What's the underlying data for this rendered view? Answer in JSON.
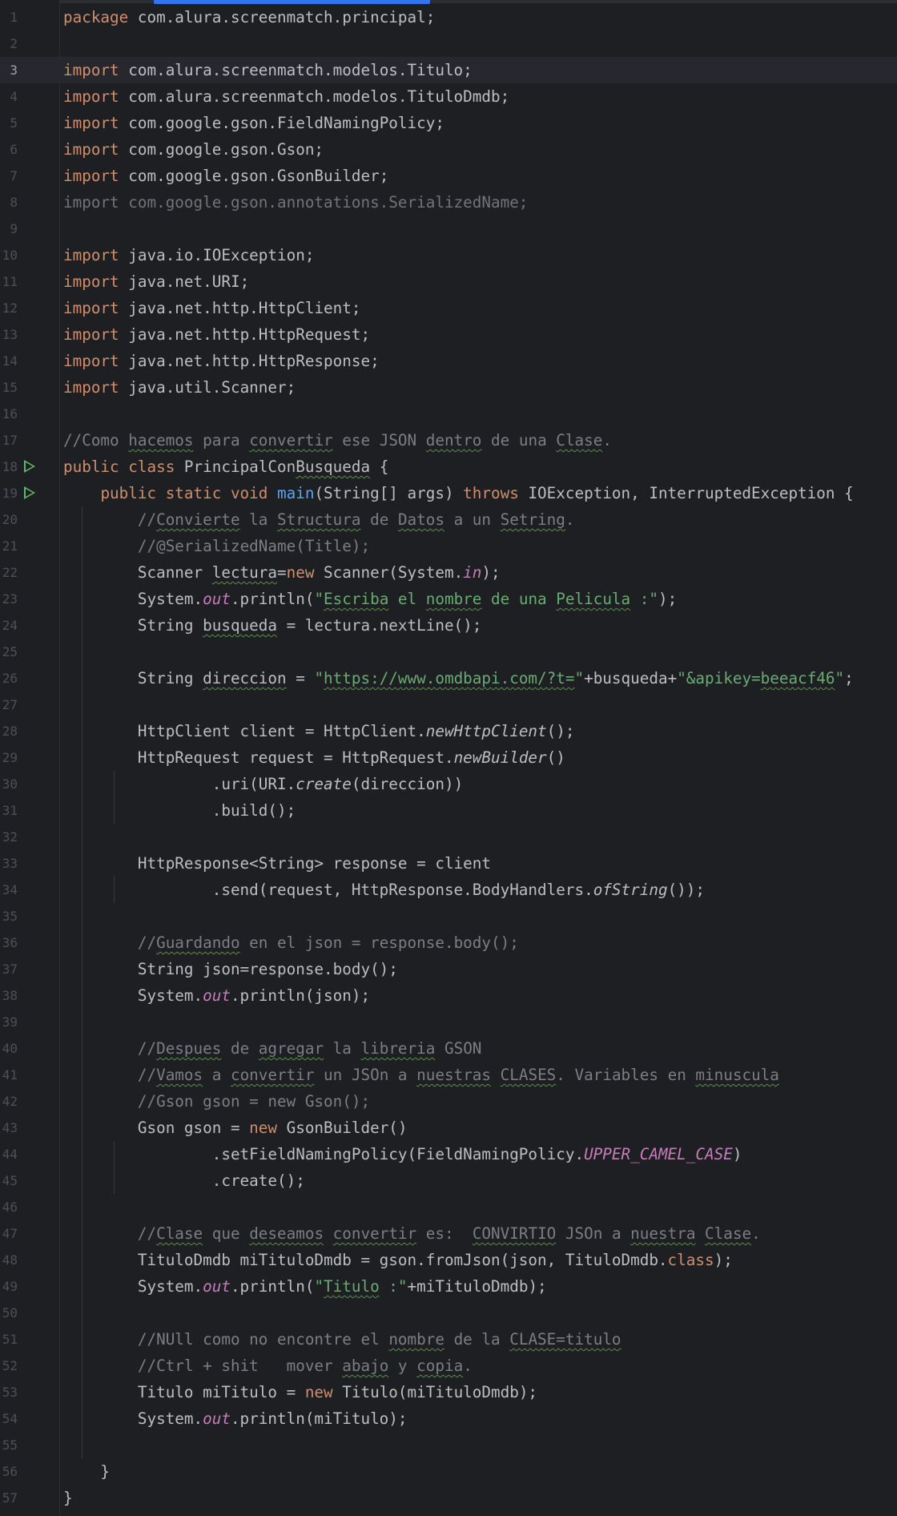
{
  "editor": {
    "current_line": 3,
    "lines": [
      {
        "n": 1,
        "tokens": [
          {
            "t": "package ",
            "c": "kw"
          },
          {
            "t": "com.alura.screenmatch.principal;"
          }
        ]
      },
      {
        "n": 2,
        "tokens": []
      },
      {
        "n": 3,
        "tokens": [
          {
            "t": "import ",
            "c": "kw"
          },
          {
            "t": "com.alura.screenmatch.modelos.Titulo;"
          }
        ]
      },
      {
        "n": 4,
        "tokens": [
          {
            "t": "import ",
            "c": "kw"
          },
          {
            "t": "com.alura.screenmatch.modelos.TituloDmdb;"
          }
        ]
      },
      {
        "n": 5,
        "tokens": [
          {
            "t": "import ",
            "c": "kw"
          },
          {
            "t": "com.google.gson.FieldNamingPolicy;"
          }
        ]
      },
      {
        "n": 6,
        "tokens": [
          {
            "t": "import ",
            "c": "kw"
          },
          {
            "t": "com.google.gson.Gson;"
          }
        ]
      },
      {
        "n": 7,
        "tokens": [
          {
            "t": "import ",
            "c": "kw"
          },
          {
            "t": "com.google.gson.GsonBuilder;"
          }
        ]
      },
      {
        "n": 8,
        "tokens": [
          {
            "t": "import com.google.gson.annotations.SerializedName;",
            "c": "dim"
          }
        ]
      },
      {
        "n": 9,
        "tokens": []
      },
      {
        "n": 10,
        "tokens": [
          {
            "t": "import ",
            "c": "kw"
          },
          {
            "t": "java.io.IOException;"
          }
        ]
      },
      {
        "n": 11,
        "tokens": [
          {
            "t": "import ",
            "c": "kw"
          },
          {
            "t": "java.net.URI;"
          }
        ]
      },
      {
        "n": 12,
        "tokens": [
          {
            "t": "import ",
            "c": "kw"
          },
          {
            "t": "java.net.http.HttpClient;"
          }
        ]
      },
      {
        "n": 13,
        "tokens": [
          {
            "t": "import ",
            "c": "kw"
          },
          {
            "t": "java.net.http.HttpRequest;"
          }
        ]
      },
      {
        "n": 14,
        "tokens": [
          {
            "t": "import ",
            "c": "kw"
          },
          {
            "t": "java.net.http.HttpResponse;"
          }
        ]
      },
      {
        "n": 15,
        "tokens": [
          {
            "t": "import ",
            "c": "kw"
          },
          {
            "t": "java.util.Scanner;"
          }
        ]
      },
      {
        "n": 16,
        "tokens": []
      },
      {
        "n": 17,
        "tokens": [
          {
            "t": "//Como ",
            "c": "cmt"
          },
          {
            "t": "hacemos",
            "c": "cmt typo"
          },
          {
            "t": " para ",
            "c": "cmt"
          },
          {
            "t": "convertir",
            "c": "cmt typo"
          },
          {
            "t": " ese JSON ",
            "c": "cmt"
          },
          {
            "t": "dentro",
            "c": "cmt typo"
          },
          {
            "t": " de una ",
            "c": "cmt"
          },
          {
            "t": "Clase",
            "c": "cmt typo"
          },
          {
            "t": ".",
            "c": "cmt"
          }
        ]
      },
      {
        "n": 18,
        "run": true,
        "tokens": [
          {
            "t": "public class ",
            "c": "kw"
          },
          {
            "t": "PrincipalCon"
          },
          {
            "t": "Busqueda",
            "c": "typo"
          },
          {
            "t": " {"
          }
        ]
      },
      {
        "n": 19,
        "run": true,
        "tokens": [
          {
            "t": "    "
          },
          {
            "t": "public static void ",
            "c": "kw"
          },
          {
            "t": "main",
            "c": "fn"
          },
          {
            "t": "(String[] args) "
          },
          {
            "t": "throws ",
            "c": "kw"
          },
          {
            "t": "IOException, InterruptedException {"
          }
        ]
      },
      {
        "n": 20,
        "tokens": [
          {
            "t": "        "
          },
          {
            "t": "//",
            "c": "cmt"
          },
          {
            "t": "Convierte",
            "c": "cmt typo"
          },
          {
            "t": " la ",
            "c": "cmt"
          },
          {
            "t": "Structura",
            "c": "cmt typo"
          },
          {
            "t": " de ",
            "c": "cmt"
          },
          {
            "t": "Datos",
            "c": "cmt typo"
          },
          {
            "t": " a un ",
            "c": "cmt"
          },
          {
            "t": "Setring",
            "c": "cmt typo"
          },
          {
            "t": ".",
            "c": "cmt"
          }
        ]
      },
      {
        "n": 21,
        "tokens": [
          {
            "t": "        "
          },
          {
            "t": "//@SerializedName(Title);",
            "c": "cmt"
          }
        ]
      },
      {
        "n": 22,
        "tokens": [
          {
            "t": "        Scanner "
          },
          {
            "t": "lectura",
            "c": "typo"
          },
          {
            "t": "="
          },
          {
            "t": "new ",
            "c": "kw"
          },
          {
            "t": "Scanner(System."
          },
          {
            "t": "in",
            "c": "fld"
          },
          {
            "t": ");"
          }
        ]
      },
      {
        "n": 23,
        "tokens": [
          {
            "t": "        System."
          },
          {
            "t": "out",
            "c": "fld"
          },
          {
            "t": ".println("
          },
          {
            "t": "\"",
            "c": "str"
          },
          {
            "t": "Escriba",
            "c": "str typo"
          },
          {
            "t": " el ",
            "c": "str"
          },
          {
            "t": "nombre",
            "c": "str typo"
          },
          {
            "t": " de una ",
            "c": "str"
          },
          {
            "t": "Pelicula",
            "c": "str typo"
          },
          {
            "t": " :\"",
            "c": "str"
          },
          {
            "t": ");"
          }
        ]
      },
      {
        "n": 24,
        "tokens": [
          {
            "t": "        String "
          },
          {
            "t": "busqueda",
            "c": "typo"
          },
          {
            "t": " = lectura.nextLine();"
          }
        ]
      },
      {
        "n": 25,
        "tokens": []
      },
      {
        "n": 26,
        "tokens": [
          {
            "t": "        String "
          },
          {
            "t": "direccion",
            "c": "typo"
          },
          {
            "t": " = "
          },
          {
            "t": "\"",
            "c": "str"
          },
          {
            "t": "https://www.omdbapi.com/?t=",
            "c": "str typo"
          },
          {
            "t": "\"",
            "c": "str"
          },
          {
            "t": "+busqueda+"
          },
          {
            "t": "\"&apikey=",
            "c": "str"
          },
          {
            "t": "beeacf46",
            "c": "str typo"
          },
          {
            "t": "\"",
            "c": "str"
          },
          {
            "t": ";"
          }
        ]
      },
      {
        "n": 27,
        "tokens": []
      },
      {
        "n": 28,
        "tokens": [
          {
            "t": "        HttpClient client = HttpClient."
          },
          {
            "t": "newHttpClient",
            "c": "ital"
          },
          {
            "t": "();"
          }
        ]
      },
      {
        "n": 29,
        "tokens": [
          {
            "t": "        HttpRequest request = HttpRequest."
          },
          {
            "t": "newBuilder",
            "c": "ital"
          },
          {
            "t": "()"
          }
        ]
      },
      {
        "n": 30,
        "tokens": [
          {
            "t": "                .uri(URI."
          },
          {
            "t": "create",
            "c": "ital"
          },
          {
            "t": "(direccion))"
          }
        ]
      },
      {
        "n": 31,
        "tokens": [
          {
            "t": "                .build();"
          }
        ]
      },
      {
        "n": 32,
        "tokens": []
      },
      {
        "n": 33,
        "tokens": [
          {
            "t": "        HttpResponse<String> response = client"
          }
        ]
      },
      {
        "n": 34,
        "tokens": [
          {
            "t": "                .send(request, HttpResponse.BodyHandlers."
          },
          {
            "t": "ofString",
            "c": "ital"
          },
          {
            "t": "());"
          }
        ]
      },
      {
        "n": 35,
        "tokens": []
      },
      {
        "n": 36,
        "tokens": [
          {
            "t": "        "
          },
          {
            "t": "//",
            "c": "cmt"
          },
          {
            "t": "Guardando",
            "c": "cmt typo"
          },
          {
            "t": " en el json = response.body();",
            "c": "cmt"
          }
        ]
      },
      {
        "n": 37,
        "tokens": [
          {
            "t": "        String json=response.body();"
          }
        ]
      },
      {
        "n": 38,
        "tokens": [
          {
            "t": "        System."
          },
          {
            "t": "out",
            "c": "fld"
          },
          {
            "t": ".println(json);"
          }
        ]
      },
      {
        "n": 39,
        "tokens": []
      },
      {
        "n": 40,
        "tokens": [
          {
            "t": "        "
          },
          {
            "t": "//",
            "c": "cmt"
          },
          {
            "t": "Despues",
            "c": "cmt typo"
          },
          {
            "t": " de ",
            "c": "cmt"
          },
          {
            "t": "agregar",
            "c": "cmt typo"
          },
          {
            "t": " la ",
            "c": "cmt"
          },
          {
            "t": "libreria",
            "c": "cmt typo"
          },
          {
            "t": " GSON",
            "c": "cmt"
          }
        ]
      },
      {
        "n": 41,
        "tokens": [
          {
            "t": "        "
          },
          {
            "t": "//",
            "c": "cmt"
          },
          {
            "t": "Vamos",
            "c": "cmt typo"
          },
          {
            "t": " a ",
            "c": "cmt"
          },
          {
            "t": "convertir",
            "c": "cmt typo"
          },
          {
            "t": " un JSOn a ",
            "c": "cmt"
          },
          {
            "t": "nuestras",
            "c": "cmt typo"
          },
          {
            "t": " ",
            "c": "cmt"
          },
          {
            "t": "CLASES",
            "c": "cmt typo"
          },
          {
            "t": ". Variables en ",
            "c": "cmt"
          },
          {
            "t": "minuscula",
            "c": "cmt typo"
          }
        ]
      },
      {
        "n": 42,
        "tokens": [
          {
            "t": "        "
          },
          {
            "t": "//Gson gson = new Gson();",
            "c": "cmt"
          }
        ]
      },
      {
        "n": 43,
        "tokens": [
          {
            "t": "        Gson gson = "
          },
          {
            "t": "new ",
            "c": "kw"
          },
          {
            "t": "GsonBuilder()"
          }
        ]
      },
      {
        "n": 44,
        "tokens": [
          {
            "t": "                .setFieldNamingPolicy(FieldNamingPolicy."
          },
          {
            "t": "UPPER_CAMEL_CASE",
            "c": "fld"
          },
          {
            "t": ")"
          }
        ]
      },
      {
        "n": 45,
        "tokens": [
          {
            "t": "                .create();"
          }
        ]
      },
      {
        "n": 46,
        "tokens": []
      },
      {
        "n": 47,
        "tokens": [
          {
            "t": "        "
          },
          {
            "t": "//",
            "c": "cmt"
          },
          {
            "t": "Clase",
            "c": "cmt typo"
          },
          {
            "t": " que ",
            "c": "cmt"
          },
          {
            "t": "deseamos",
            "c": "cmt typo"
          },
          {
            "t": " ",
            "c": "cmt"
          },
          {
            "t": "convertir",
            "c": "cmt typo"
          },
          {
            "t": " es:  ",
            "c": "cmt"
          },
          {
            "t": "CONVIRTIO",
            "c": "cmt typo"
          },
          {
            "t": " JSOn a ",
            "c": "cmt"
          },
          {
            "t": "nuestra",
            "c": "cmt typo"
          },
          {
            "t": " ",
            "c": "cmt"
          },
          {
            "t": "Clase",
            "c": "cmt typo"
          },
          {
            "t": ".",
            "c": "cmt"
          }
        ]
      },
      {
        "n": 48,
        "tokens": [
          {
            "t": "        TituloDmdb miTituloDmdb = gson.fromJson(json, TituloDmdb."
          },
          {
            "t": "class",
            "c": "kw"
          },
          {
            "t": ");"
          }
        ]
      },
      {
        "n": 49,
        "tokens": [
          {
            "t": "        System."
          },
          {
            "t": "out",
            "c": "fld"
          },
          {
            "t": ".println("
          },
          {
            "t": "\"",
            "c": "str"
          },
          {
            "t": "Titulo",
            "c": "str typo"
          },
          {
            "t": " :\"",
            "c": "str"
          },
          {
            "t": "+miTituloDmdb);"
          }
        ]
      },
      {
        "n": 50,
        "tokens": []
      },
      {
        "n": 51,
        "tokens": [
          {
            "t": "        "
          },
          {
            "t": "//NUll como no encontre el ",
            "c": "cmt"
          },
          {
            "t": "nombre",
            "c": "cmt typo"
          },
          {
            "t": " de la ",
            "c": "cmt"
          },
          {
            "t": "CLASE=titulo",
            "c": "cmt typo"
          }
        ]
      },
      {
        "n": 52,
        "tokens": [
          {
            "t": "        "
          },
          {
            "t": "//Ctrl + shit   mover ",
            "c": "cmt"
          },
          {
            "t": "abajo",
            "c": "cmt typo"
          },
          {
            "t": " y ",
            "c": "cmt"
          },
          {
            "t": "copia",
            "c": "cmt typo"
          },
          {
            "t": ".",
            "c": "cmt"
          }
        ]
      },
      {
        "n": 53,
        "tokens": [
          {
            "t": "        Titulo miTitulo = "
          },
          {
            "t": "new ",
            "c": "kw"
          },
          {
            "t": "Titulo(miTituloDmdb);"
          }
        ]
      },
      {
        "n": 54,
        "tokens": [
          {
            "t": "        System."
          },
          {
            "t": "out",
            "c": "fld"
          },
          {
            "t": ".println(miTitulo);"
          }
        ]
      },
      {
        "n": 55,
        "tokens": []
      },
      {
        "n": 56,
        "tokens": [
          {
            "t": "    }"
          }
        ]
      },
      {
        "n": 57,
        "tokens": [
          {
            "t": "}"
          }
        ]
      }
    ]
  }
}
